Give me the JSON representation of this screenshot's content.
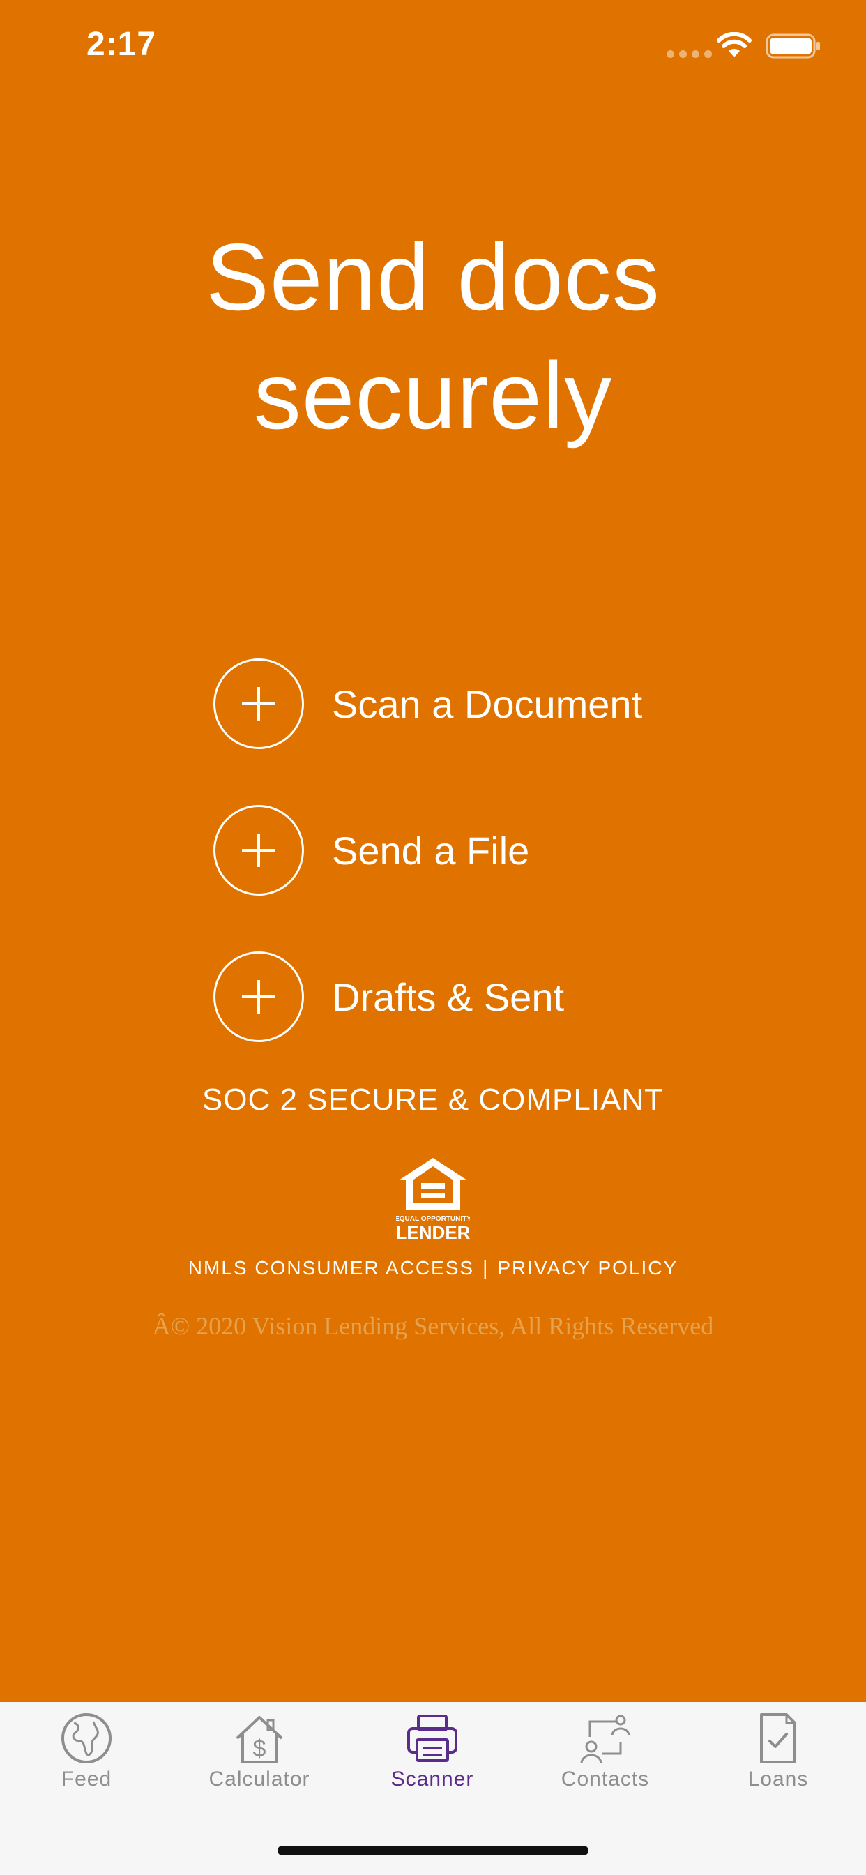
{
  "status_bar": {
    "time": "2:17"
  },
  "headline": {
    "line1": "Send docs",
    "line2": "securely"
  },
  "actions": [
    {
      "label": "Scan a Document"
    },
    {
      "label": "Send a File"
    },
    {
      "label": "Drafts & Sent"
    }
  ],
  "compliance": {
    "soc": "SOC 2 SECURE & COMPLIANT",
    "logo_text_small": "EQUAL OPPORTUNITY",
    "logo_text_large": "LENDER"
  },
  "footer_links": {
    "nmls": "NMLS CONSUMER ACCESS",
    "separator": "|",
    "privacy": "PRIVACY POLICY"
  },
  "copyright": "Â© 2020 Vision Lending Services, All Rights Reserved",
  "tab_bar": {
    "tabs": [
      {
        "label": "Feed",
        "icon": "globe-icon"
      },
      {
        "label": "Calculator",
        "icon": "house-dollar-icon"
      },
      {
        "label": "Scanner",
        "icon": "printer-icon",
        "active": true
      },
      {
        "label": "Contacts",
        "icon": "contacts-icon"
      },
      {
        "label": "Loans",
        "icon": "document-check-icon"
      }
    ]
  },
  "colors": {
    "background": "#E07300",
    "tab_bar_bg": "#F6F6F6",
    "tab_inactive": "#8E8E8E",
    "tab_active": "#5B2D8A",
    "copyright": "#E5A24F"
  }
}
